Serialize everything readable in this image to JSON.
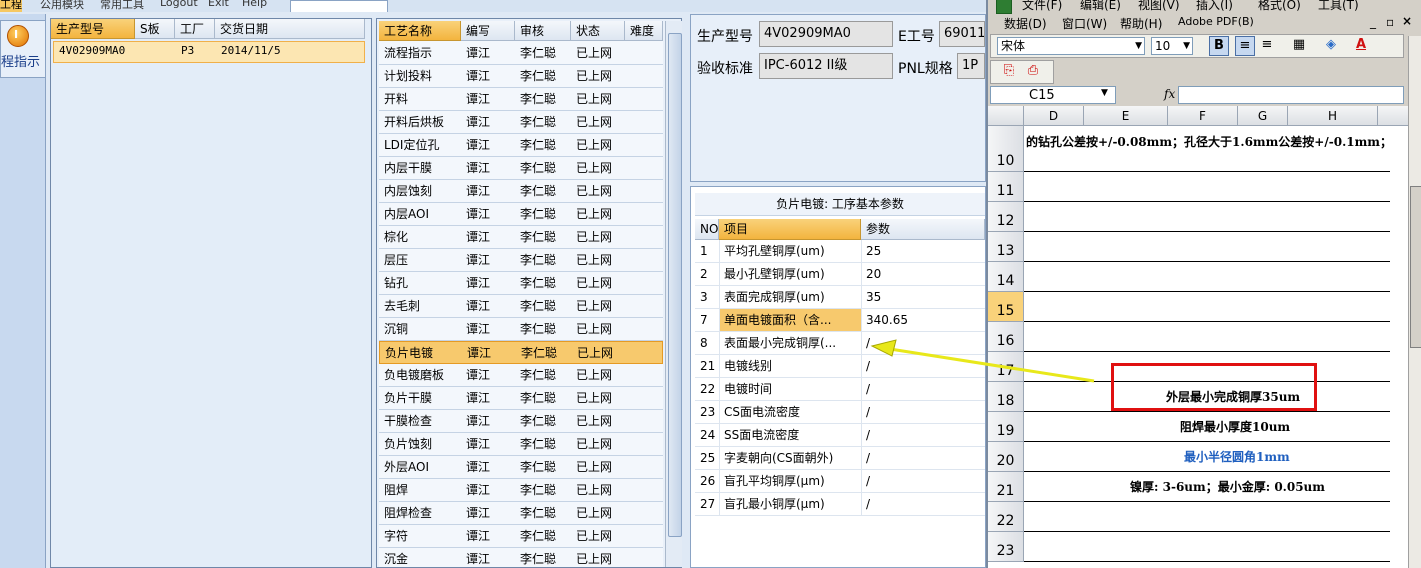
{
  "top_menu": {
    "items": [
      "工程",
      "公用模块",
      "常用工具",
      "Logout",
      "Exit",
      "Help"
    ],
    "selected_index": 0
  },
  "left_nav": {
    "button_label": "程指示"
  },
  "orders_panel": {
    "columns": [
      "生产型号",
      "S板",
      "工厂",
      "交货日期"
    ],
    "rows": [
      {
        "model": "4V02909MA0",
        "s": "",
        "factory": "P3",
        "date": "2014/11/5"
      }
    ]
  },
  "process_panel": {
    "columns": [
      "工艺名称",
      "编写",
      "审核",
      "状态",
      "难度"
    ],
    "rows": [
      [
        "流程指示",
        "谭江",
        "李仁聪",
        "已上网"
      ],
      [
        "计划投料",
        "谭江",
        "李仁聪",
        "已上网"
      ],
      [
        "开料",
        "谭江",
        "李仁聪",
        "已上网"
      ],
      [
        "开料后烘板",
        "谭江",
        "李仁聪",
        "已上网"
      ],
      [
        "LDI定位孔",
        "谭江",
        "李仁聪",
        "已上网"
      ],
      [
        "内层干膜",
        "谭江",
        "李仁聪",
        "已上网"
      ],
      [
        "内层蚀刻",
        "谭江",
        "李仁聪",
        "已上网"
      ],
      [
        "内层AOI",
        "谭江",
        "李仁聪",
        "已上网"
      ],
      [
        "棕化",
        "谭江",
        "李仁聪",
        "已上网"
      ],
      [
        "层压",
        "谭江",
        "李仁聪",
        "已上网"
      ],
      [
        "钻孔",
        "谭江",
        "李仁聪",
        "已上网"
      ],
      [
        "去毛刺",
        "谭江",
        "李仁聪",
        "已上网"
      ],
      [
        "沉铜",
        "谭江",
        "李仁聪",
        "已上网"
      ],
      [
        "负片电镀",
        "谭江",
        "李仁聪",
        "已上网"
      ],
      [
        "负电镀磨板",
        "谭江",
        "李仁聪",
        "已上网"
      ],
      [
        "负片干膜",
        "谭江",
        "李仁聪",
        "已上网"
      ],
      [
        "干膜检查",
        "谭江",
        "李仁聪",
        "已上网"
      ],
      [
        "负片蚀刻",
        "谭江",
        "李仁聪",
        "已上网"
      ],
      [
        "外层AOI",
        "谭江",
        "李仁聪",
        "已上网"
      ],
      [
        "阻焊",
        "谭江",
        "李仁聪",
        "已上网"
      ],
      [
        "阻焊检查",
        "谭江",
        "李仁聪",
        "已上网"
      ],
      [
        "字符",
        "谭江",
        "李仁聪",
        "已上网"
      ],
      [
        "沉金",
        "谭江",
        "李仁聪",
        "已上网"
      ]
    ],
    "selected_index": 13
  },
  "info": {
    "model_label": "生产型号",
    "model_value": "4V02909MA0",
    "e_label": "E工号",
    "e_value": "69011",
    "std_label": "验收标准",
    "std_value": "IPC-6012 II级",
    "pnl_label": "PNL规格",
    "pnl_value": "1P"
  },
  "params_panel": {
    "title": "负片电镀: 工序基本参数",
    "columns": [
      "NO",
      "项目",
      "参数"
    ],
    "rows": [
      [
        "1",
        "平均孔壁铜厚(um)",
        "25"
      ],
      [
        "2",
        "最小孔壁铜厚(um)",
        "20"
      ],
      [
        "3",
        "表面完成铜厚(um)",
        "35"
      ],
      [
        "7",
        "单面电镀面积（含...",
        "340.65"
      ],
      [
        "8",
        "表面最小完成铜厚(...",
        "/"
      ],
      [
        "21",
        "电镀线别",
        "/"
      ],
      [
        "22",
        "电镀时间",
        "/"
      ],
      [
        "23",
        "CS面电流密度",
        "/"
      ],
      [
        "24",
        "SS面电流密度",
        "/"
      ],
      [
        "25",
        "字麦朝向(CS面朝外)",
        "/"
      ],
      [
        "26",
        "盲孔平均铜厚(μm)",
        "/"
      ],
      [
        "27",
        "盲孔最小铜厚(μm)",
        "/"
      ]
    ],
    "highlight_index": 3
  },
  "excel": {
    "menu_row1": [
      "文件(F)",
      "编辑(E)",
      "视图(V)",
      "插入(I)",
      "格式(O)",
      "工具(T)"
    ],
    "menu_row2": [
      "数据(D)",
      "窗口(W)",
      "帮助(H)",
      "Adobe PDF(B)"
    ],
    "font_name": "宋体",
    "font_size": "10",
    "name_box": "C15",
    "fx": "fx",
    "columns": [
      "D",
      "E",
      "F",
      "G",
      "H"
    ],
    "rows": [
      "10",
      "11",
      "12",
      "13",
      "14",
      "15",
      "16",
      "17",
      "18",
      "19",
      "20",
      "21",
      "22",
      "23"
    ],
    "row10_text": "的钻孔公差按+/-0.08mm；孔径大于1.6mm公差按+/-0.1mm；",
    "row18_text": "外层最小完成铜厚35um",
    "row19_text": "阻焊最小厚度10um",
    "row20_text": "最小半径圆角1mm",
    "row21_text": "镍厚: 3-6um；最小金厚: 0.05um",
    "row20_color": "#1f5fbf"
  }
}
